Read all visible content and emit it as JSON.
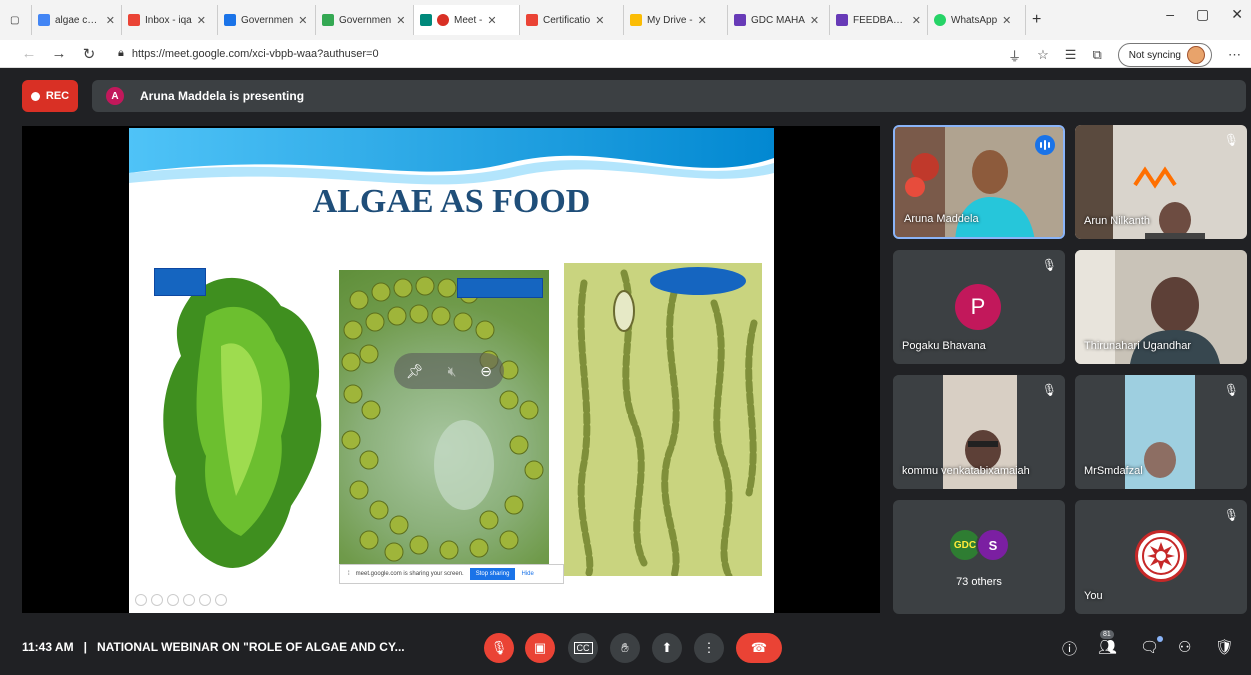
{
  "browser": {
    "tabs": [
      {
        "label": "algae cyan",
        "fav": "#4285f4",
        "icon": "google-icon"
      },
      {
        "label": "Inbox - iqa",
        "fav": "#ea4335",
        "icon": "gmail-icon"
      },
      {
        "label": "Governmen",
        "fav": "#1a73e8",
        "icon": "doc-icon"
      },
      {
        "label": "Governmen",
        "fav": "#34a853",
        "icon": "doc-icon"
      },
      {
        "label": "Meet -",
        "fav": "#00897b",
        "icon": "meet-icon"
      },
      {
        "label": "Certificatio",
        "fav": "#ea4335",
        "icon": "gmail-icon"
      },
      {
        "label": "My Drive -",
        "fav": "#fbbc04",
        "icon": "drive-icon"
      },
      {
        "label": "GDC MAHA",
        "fav": "#673ab7",
        "icon": "forms-icon"
      },
      {
        "label": "FEEDBACK",
        "fav": "#673ab7",
        "icon": "forms-icon"
      },
      {
        "label": "WhatsApp",
        "fav": "#25d366",
        "icon": "whatsapp-icon"
      }
    ],
    "url": "https://meet.google.com/xci-vbpb-waa?authuser=0",
    "sync_label": "Not syncing"
  },
  "meet": {
    "rec_label": "REC",
    "presenter_initial": "A",
    "presenting_text": "Aruna Maddela is presenting",
    "slide": {
      "title": "ALGAE AS FOOD",
      "share_text": "meet.google.com is sharing your screen.",
      "stop_label": "Stop sharing",
      "hide_label": "Hide"
    },
    "participants": {
      "p1": "Aruna Maddela",
      "p2": "Arun Nilkanth",
      "p3": "Pogaku Bhavana",
      "p3_initial": "P",
      "p4": "Thirunahari Ugandhar",
      "p5": "kommu venkatabixamaiah",
      "p6": "MrSmdafzal",
      "others_initial_a": "GDC",
      "others_initial_b": "S",
      "others_label": "73 others",
      "you": "You"
    },
    "bottom": {
      "time": "11:43 AM",
      "separator": "|",
      "title": "NATIONAL WEBINAR ON \"ROLE OF ALGAE AND CY...",
      "people_count": "81"
    }
  },
  "colors": {
    "accent": "#1a73e8",
    "danger": "#ea4335",
    "surface": "#3c4043"
  }
}
